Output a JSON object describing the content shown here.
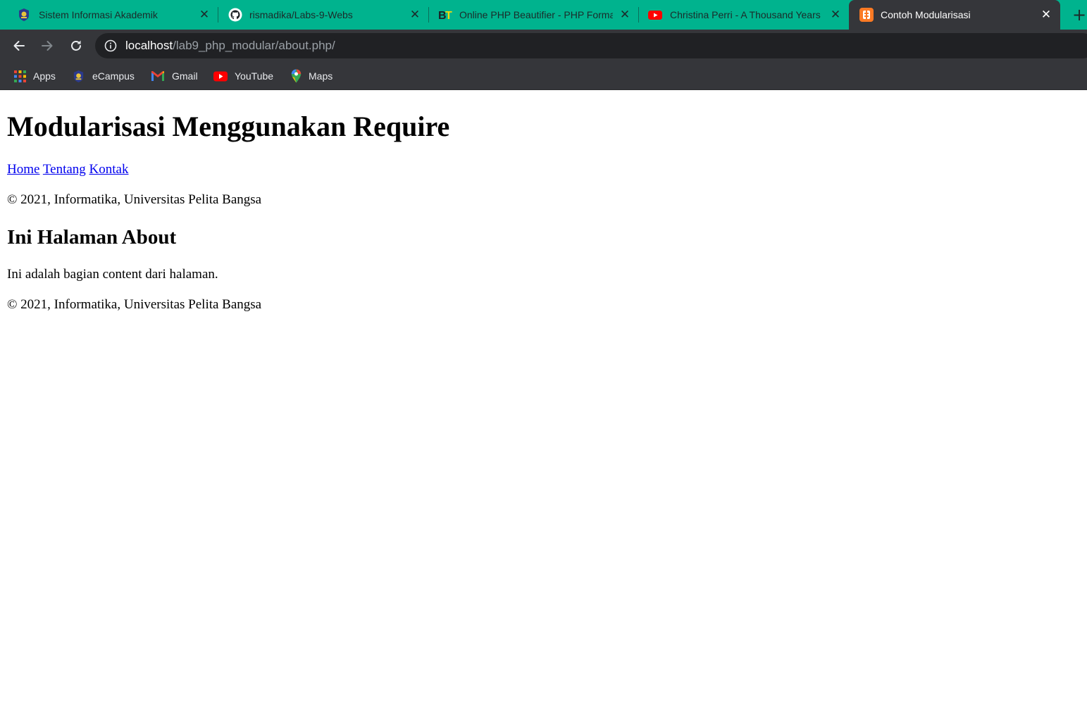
{
  "browser": {
    "tabs": [
      {
        "title": "Sistem Informasi Akademik",
        "icon": "university-crest-icon",
        "active": false
      },
      {
        "title": "rismadika/Labs-9-Webs",
        "icon": "github-icon",
        "active": false
      },
      {
        "title": "Online PHP Beautifier - PHP Formatter",
        "icon": "bt-logo-icon",
        "active": false
      },
      {
        "title": "Christina Perri - A Thousand Years",
        "icon": "youtube-icon",
        "active": false
      },
      {
        "title": "Contoh Modularisasi",
        "icon": "xampp-icon",
        "active": true
      }
    ],
    "new_tab_symbol": "+",
    "close_symbol": "✕",
    "address": {
      "host": "localhost",
      "path": "/lab9_php_modular/about.php/"
    },
    "bookmarks": [
      {
        "label": "Apps",
        "icon": "apps-grid-icon"
      },
      {
        "label": "eCampus",
        "icon": "university-crest-icon"
      },
      {
        "label": "Gmail",
        "icon": "gmail-icon"
      },
      {
        "label": "YouTube",
        "icon": "youtube-icon"
      },
      {
        "label": "Maps",
        "icon": "maps-pin-icon"
      }
    ],
    "colors": {
      "tab_strip": "#00b38e",
      "toolbar": "#35363a",
      "omnibox": "#202124"
    }
  },
  "page": {
    "heading": "Modularisasi Menggunakan Require",
    "nav": [
      {
        "label": "Home"
      },
      {
        "label": "Tentang"
      },
      {
        "label": "Kontak"
      }
    ],
    "footer_top": "© 2021, Informatika, Universitas Pelita Bangsa",
    "subheading": "Ini Halaman About",
    "content": "Ini adalah bagian content dari halaman.",
    "footer_bottom": "© 2021, Informatika, Universitas Pelita Bangsa",
    "link_color": "#0000ee"
  }
}
